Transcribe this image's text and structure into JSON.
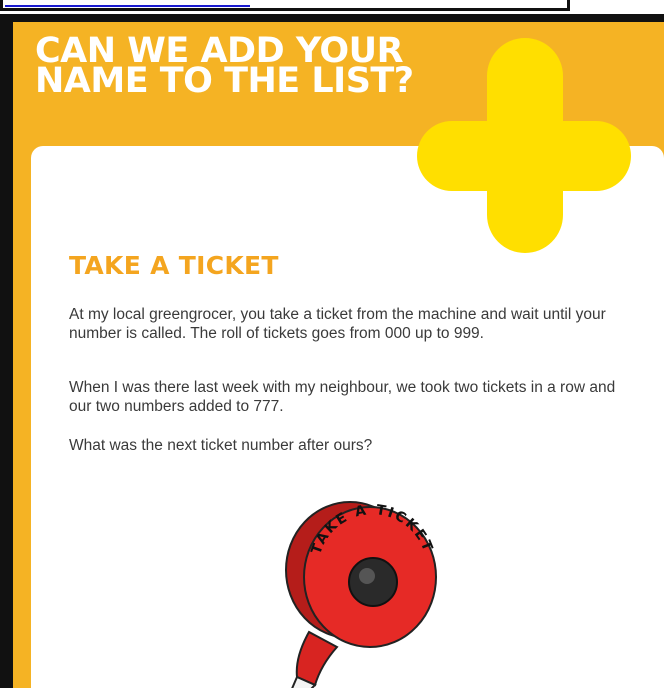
{
  "poster": {
    "heading_line1": "CAN WE ADD YOUR",
    "heading_line2": "NAME TO THE LIST?",
    "title": "TAKE A TICKET",
    "paragraphs": [
      "At my local greengrocer, you take a ticket from the machine and wait until your number is called. The roll of tickets goes from 000 up to 999.",
      "When I was there last week with my neighbour, we took two tickets in a row and our two numbers added to 777.",
      "What was the next ticket number after ours?"
    ],
    "dispenser_label": "TAKE A TICKET"
  },
  "colors": {
    "background_orange": "#f5b324",
    "plus_yellow": "#ffdf00",
    "title_orange": "#f4a51f",
    "dispenser_red": "#e62a26",
    "body_text": "#3a3a3a"
  },
  "icons": {
    "decoration": "plus-icon",
    "illustration": "ticket-dispenser-icon"
  }
}
